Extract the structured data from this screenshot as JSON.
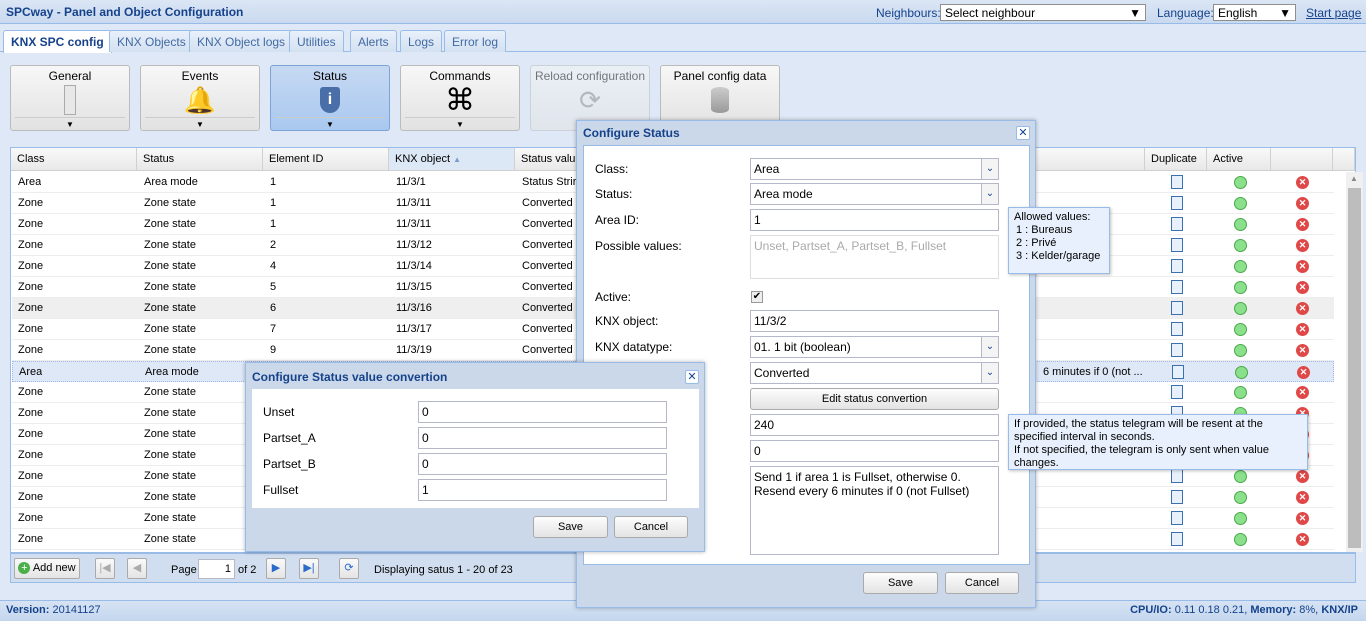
{
  "header": {
    "title": "SPCway - Panel and Object Configuration",
    "neighbours_label": "Neighbours:",
    "neighbour_value": "Select neighbour",
    "language_label": "Language:",
    "language_value": "English",
    "start_page": "Start page"
  },
  "tabs": [
    "KNX SPC config",
    "KNX Objects",
    "KNX Object logs",
    "Utilities",
    "Alerts",
    "Logs",
    "Error log"
  ],
  "toolbar": [
    {
      "label": "General",
      "icon": "panel-icon"
    },
    {
      "label": "Events",
      "icon": "bell-icon"
    },
    {
      "label": "Status",
      "icon": "info-shield-icon"
    },
    {
      "label": "Commands",
      "icon": "command-icon"
    },
    {
      "label": "Reload configuration",
      "icon": "reload-icon"
    },
    {
      "label": "Panel config data",
      "icon": "database-icon"
    }
  ],
  "grid": {
    "columns": [
      "Class",
      "Status",
      "Element ID",
      "KNX object",
      "Status valu",
      "Duplicate",
      "Active"
    ],
    "rows": [
      [
        "Area",
        "Area mode",
        "1",
        "11/3/1",
        "Status Strir",
        ""
      ],
      [
        "Zone",
        "Zone state",
        "1",
        "11/3/11",
        "Converted",
        ""
      ],
      [
        "Zone",
        "Zone state",
        "1",
        "11/3/11",
        "Converted",
        ""
      ],
      [
        "Zone",
        "Zone state",
        "2",
        "11/3/12",
        "Converted",
        ""
      ],
      [
        "Zone",
        "Zone state",
        "4",
        "11/3/14",
        "Converted",
        ""
      ],
      [
        "Zone",
        "Zone state",
        "5",
        "11/3/15",
        "Converted",
        ""
      ],
      [
        "Zone",
        "Zone state",
        "6",
        "11/3/16",
        "Converted",
        ""
      ],
      [
        "Zone",
        "Zone state",
        "7",
        "11/3/17",
        "Converted",
        ""
      ],
      [
        "Zone",
        "Zone state",
        "9",
        "11/3/19",
        "Converted",
        ""
      ],
      [
        "Area",
        "Area mode",
        "",
        "",
        "",
        "6 minutes if 0 (not ..."
      ],
      [
        "Zone",
        "Zone state",
        "",
        "",
        "",
        ""
      ],
      [
        "Zone",
        "Zone state",
        "",
        "",
        "",
        ""
      ],
      [
        "Zone",
        "Zone state",
        "",
        "",
        "",
        ""
      ],
      [
        "Zone",
        "Zone state",
        "",
        "",
        "",
        ""
      ],
      [
        "Zone",
        "Zone state",
        "",
        "",
        "",
        ""
      ],
      [
        "Zone",
        "Zone state",
        "",
        "",
        "",
        ""
      ],
      [
        "Zone",
        "Zone state",
        "",
        "",
        "",
        ""
      ],
      [
        "Zone",
        "Zone state",
        "",
        "",
        "",
        ""
      ]
    ]
  },
  "pager": {
    "add_new": "Add new",
    "page_label": "Page",
    "page": "1",
    "of": "of 2",
    "display": "Displaying satus 1 - 20 of 23"
  },
  "footer": {
    "version_label": "Version:",
    "version": "20141127",
    "cpu_label": "CPU/IO:",
    "cpu": "0.11 0.18 0.21,",
    "mem_label": "Memory:",
    "mem": "8%,",
    "knx": "KNX/IP"
  },
  "dialog": {
    "title": "Configure Status",
    "class_label": "Class:",
    "class_value": "Area",
    "status_label": "Status:",
    "status_value": "Area mode",
    "area_label": "Area ID:",
    "area_value": "1",
    "possible_label": "Possible values:",
    "possible_placeholder": "Unset, Partset_A, Partset_B, Fullset",
    "active_label": "Active:",
    "knx_obj_label": "KNX object:",
    "knx_obj_value": "11/3/2",
    "datatype_label": "KNX datatype:",
    "datatype_value": "01. 1 bit (boolean)",
    "mode_value": "Converted",
    "edit_conv": "Edit status convertion",
    "interval_value": "240",
    "other_value": "0",
    "description": "Send 1 if area 1 is Fullset, otherwise 0.\nResend every 6 minutes if 0 (not Fullset)",
    "save": "Save",
    "cancel": "Cancel"
  },
  "tooltip_area": {
    "title": "Allowed values:",
    "items": [
      "1 : Bureaus",
      "2 : Privé",
      "3 : Kelder/garage"
    ]
  },
  "tooltip_interval": {
    "line1": "If provided, the status telegram will be resent at the specified interval in seconds.",
    "line2": "If not specified, the telegram is only sent when value changes."
  },
  "conv": {
    "title": "Configure Status value convertion",
    "fields": [
      {
        "label": "Unset",
        "value": "0"
      },
      {
        "label": "Partset_A",
        "value": "0"
      },
      {
        "label": "Partset_B",
        "value": "0"
      },
      {
        "label": "Fullset",
        "value": "1"
      }
    ],
    "save": "Save",
    "cancel": "Cancel"
  }
}
